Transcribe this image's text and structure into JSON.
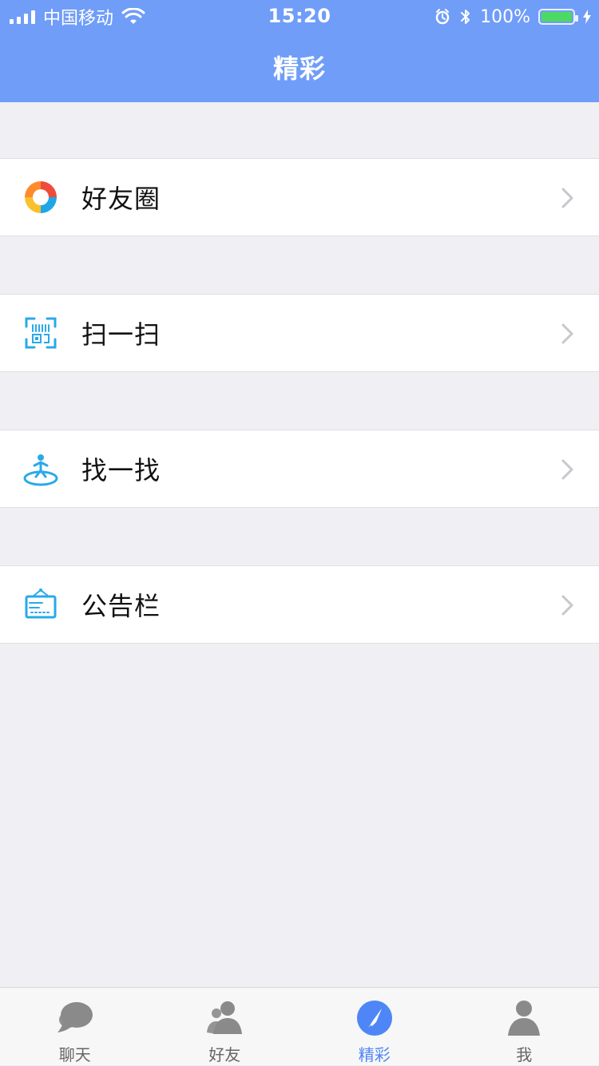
{
  "status_bar": {
    "carrier": "中国移动",
    "time": "15:20",
    "battery_text": "100%",
    "icons": {
      "signal": "signal-icon",
      "wifi": "wifi-icon",
      "alarm": "alarm-icon",
      "bluetooth": "bluetooth-icon",
      "battery": "battery-icon",
      "charging": "charging-icon"
    }
  },
  "header": {
    "title": "精彩"
  },
  "menu": {
    "items": [
      {
        "label": "好友圈",
        "icon": "moments-icon"
      },
      {
        "label": "扫一扫",
        "icon": "scan-icon"
      },
      {
        "label": "找一找",
        "icon": "discover-person-icon"
      },
      {
        "label": "公告栏",
        "icon": "notice-board-icon"
      }
    ]
  },
  "tabbar": {
    "active_index": 2,
    "tabs": [
      {
        "label": "聊天",
        "icon": "chat-bubble-icon"
      },
      {
        "label": "好友",
        "icon": "friends-icon"
      },
      {
        "label": "精彩",
        "icon": "compass-icon"
      },
      {
        "label": "我",
        "icon": "profile-icon"
      }
    ]
  },
  "colors": {
    "nav_bg": "#6f9df8",
    "page_bg": "#efeff4",
    "tab_active": "#4f86f7",
    "tab_inactive": "#8a8a8a",
    "battery_fill": "#4cd964"
  }
}
